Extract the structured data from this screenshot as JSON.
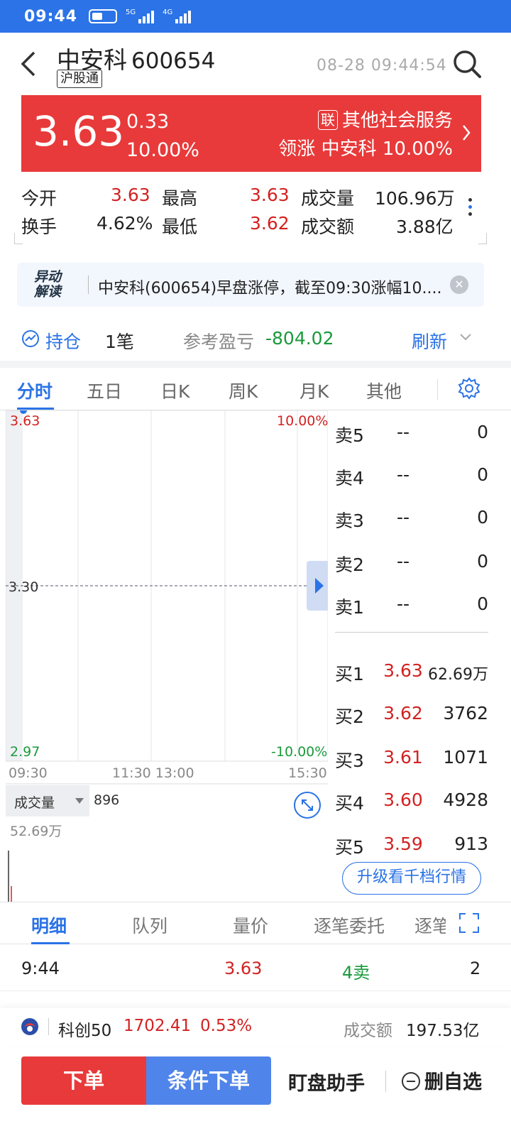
{
  "status_bar": {
    "time": "09:44",
    "network_1": "5G",
    "network_2": "4G"
  },
  "header": {
    "stock_name": "中安科",
    "stock_code": "600654",
    "tag": "沪股通",
    "datetime": "08-28 09:44:54"
  },
  "quote": {
    "price": "3.63",
    "change": "0.33",
    "change_pct": "10.00%",
    "sector_badge": "联",
    "sector": "其他社会服务",
    "leader_label": "领涨",
    "leader_name": "中安科",
    "leader_pct": "10.00%",
    "color": "#e83a3a"
  },
  "stats": {
    "open_label": "今开",
    "open": "3.63",
    "high_label": "最高",
    "high": "3.63",
    "volume_label": "成交量",
    "volume": "106.96万",
    "turnover_label": "换手",
    "turnover": "4.62%",
    "low_label": "最低",
    "low": "3.62",
    "amount_label": "成交额",
    "amount": "3.88亿"
  },
  "news": {
    "logo_line1": "异动",
    "logo_line2": "解读",
    "text": "中安科(600654)早盘涨停，截至09:30涨幅10...."
  },
  "holding": {
    "label": "持仓",
    "count": "1笔",
    "pnl_label": "参考盈亏",
    "pnl": "-804.02",
    "refresh": "刷新"
  },
  "chart_tabs": [
    "分时",
    "五日",
    "日K",
    "周K",
    "月K",
    "其他"
  ],
  "chart": {
    "price_top": "3.63",
    "pct_top": "10.00%",
    "price_mid": "3.30",
    "price_bottom": "2.97",
    "pct_bottom": "-10.00%",
    "time_labels": [
      "09:30",
      "11:30 13:00",
      "15:30"
    ],
    "volume_selector": "成交量",
    "volume_value": "896",
    "volume_max": "52.69万"
  },
  "order_book": {
    "asks": [
      {
        "label": "卖5",
        "price": "--",
        "volume": "0"
      },
      {
        "label": "卖4",
        "price": "--",
        "volume": "0"
      },
      {
        "label": "卖3",
        "price": "--",
        "volume": "0"
      },
      {
        "label": "卖2",
        "price": "--",
        "volume": "0"
      },
      {
        "label": "卖1",
        "price": "--",
        "volume": "0"
      }
    ],
    "bids": [
      {
        "label": "买1",
        "price": "3.63",
        "volume": "62.69万"
      },
      {
        "label": "买2",
        "price": "3.62",
        "volume": "3762"
      },
      {
        "label": "买3",
        "price": "3.61",
        "volume": "1071"
      },
      {
        "label": "买4",
        "price": "3.60",
        "volume": "4928"
      },
      {
        "label": "买5",
        "price": "3.59",
        "volume": "913"
      }
    ],
    "upgrade_label": "升级看千档行情"
  },
  "detail_tabs": [
    "明细",
    "队列",
    "量价",
    "逐笔委托",
    "逐笔"
  ],
  "trades": [
    {
      "time": "9:44",
      "price": "3.63",
      "side": "4卖",
      "count": "2"
    }
  ],
  "index_bar": {
    "name": "科创50",
    "value": "1702.41",
    "pct": "0.53%",
    "amount_label": "成交额",
    "amount": "197.53亿"
  },
  "actions": {
    "order": "下单",
    "conditional_order": "条件下单",
    "assistant": "盯盘助手",
    "remove_watch": "删自选"
  }
}
